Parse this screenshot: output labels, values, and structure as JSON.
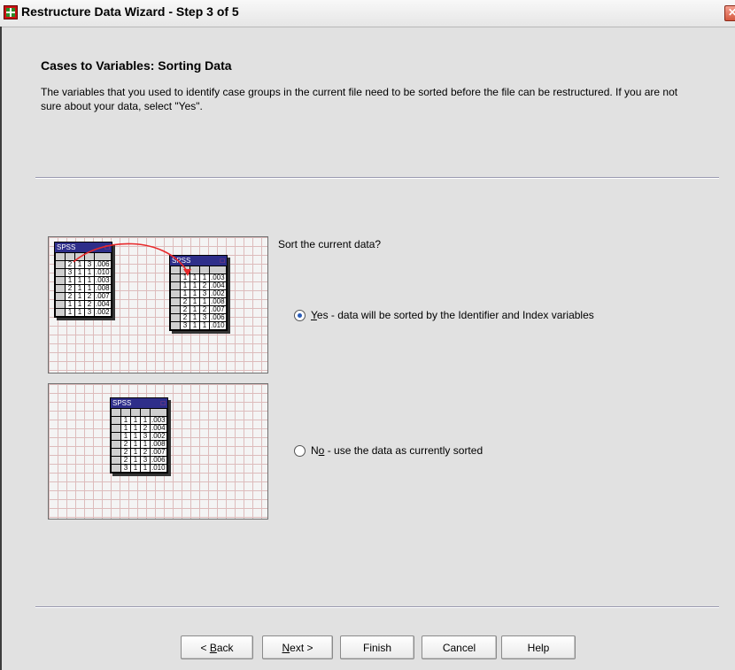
{
  "window": {
    "title": "Restructure Data Wizard - Step 3 of 5",
    "close_glyph": "✕"
  },
  "header": {
    "heading": "Cases to Variables: Sorting Data",
    "description": "The variables that you used to identify case groups in the current file need to be sorted before the file can be restructured. If you are not sure about your data, select \"Yes\"."
  },
  "illustration_sorted": {
    "unsorted_table": {
      "caption": "SPSS",
      "rows": [
        [
          "2",
          "1",
          "3",
          ".006"
        ],
        [
          "3",
          "1",
          "1",
          ".010"
        ],
        [
          "1",
          "1",
          "1",
          ".003"
        ],
        [
          "2",
          "1",
          "1",
          ".008"
        ],
        [
          "2",
          "1",
          "2",
          ".007"
        ],
        [
          "1",
          "1",
          "2",
          ".004"
        ],
        [
          "1",
          "1",
          "3",
          ".002"
        ]
      ]
    },
    "sorted_table": {
      "caption": "SPSS",
      "rows": [
        [
          "1",
          "1",
          "1",
          ".003"
        ],
        [
          "1",
          "1",
          "2",
          ".004"
        ],
        [
          "1",
          "1",
          "3",
          ".002"
        ],
        [
          "2",
          "1",
          "1",
          ".008"
        ],
        [
          "2",
          "1",
          "2",
          ".007"
        ],
        [
          "2",
          "1",
          "3",
          ".006"
        ],
        [
          "3",
          "1",
          "1",
          ".010"
        ]
      ]
    },
    "arrow_color": "#e8282a"
  },
  "illustration_current": {
    "table": {
      "caption": "SPSS",
      "rows": [
        [
          "1",
          "1",
          "1",
          ".003"
        ],
        [
          "1",
          "1",
          "2",
          ".004"
        ],
        [
          "1",
          "1",
          "3",
          ".002"
        ],
        [
          "2",
          "1",
          "1",
          ".008"
        ],
        [
          "2",
          "1",
          "2",
          ".007"
        ],
        [
          "2",
          "1",
          "3",
          ".006"
        ],
        [
          "3",
          "1",
          "1",
          ".010"
        ]
      ]
    }
  },
  "options": {
    "question": "Sort the current data?",
    "yes": {
      "mnemonic": "Y",
      "label_rest": "es - data will be sorted by the Identifier and Index variables",
      "selected": true
    },
    "no": {
      "label_pre": "N",
      "mnemonic": "o",
      "label_rest": " - use the data as currently sorted",
      "selected": false
    }
  },
  "buttons": {
    "back_prefix": "< ",
    "back_mnemonic": "B",
    "back_rest": "ack",
    "next_mnemonic": "N",
    "next_rest": "ext >",
    "finish": "Finish",
    "cancel": "Cancel",
    "help": "Help"
  },
  "colors": {
    "accent_blue": "#2e2e8a",
    "grid_line": "#ddbcbc",
    "radio_dot": "#2a5cb8"
  }
}
